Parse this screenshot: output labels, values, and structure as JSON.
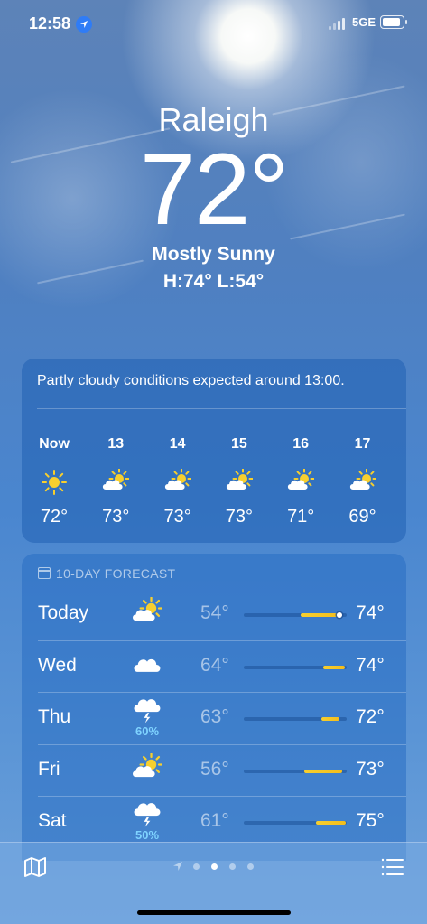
{
  "status_bar": {
    "time": "12:58",
    "network": "5GE"
  },
  "current": {
    "city": "Raleigh",
    "temperature": "72°",
    "condition": "Mostly Sunny",
    "high_low": "H:74°  L:54°"
  },
  "hourly": {
    "summary": "Partly cloudy conditions expected around 13:00.",
    "hours": [
      {
        "label": "Now",
        "icon": "sun-icon",
        "temp": "72°"
      },
      {
        "label": "13",
        "icon": "partly-cloudy-icon",
        "temp": "73°"
      },
      {
        "label": "14",
        "icon": "partly-cloudy-icon",
        "temp": "73°"
      },
      {
        "label": "15",
        "icon": "partly-cloudy-icon",
        "temp": "73°"
      },
      {
        "label": "16",
        "icon": "partly-cloudy-icon",
        "temp": "71°"
      },
      {
        "label": "17",
        "icon": "partly-cloudy-icon",
        "temp": "69°"
      }
    ]
  },
  "daily": {
    "header": "10-DAY FORECAST",
    "days": [
      {
        "name": "Today",
        "icon": "partly-cloudy-icon",
        "pop": "",
        "low": "54°",
        "high": "74°",
        "bar_start": 0.55,
        "bar_end": 0.95,
        "current_marker": 0.93
      },
      {
        "name": "Wed",
        "icon": "cloud-icon",
        "pop": "",
        "low": "64°",
        "high": "74°",
        "bar_start": 0.77,
        "bar_end": 0.98
      },
      {
        "name": "Thu",
        "icon": "thunderstorm-icon",
        "pop": "60%",
        "low": "63°",
        "high": "72°",
        "bar_start": 0.75,
        "bar_end": 0.93
      },
      {
        "name": "Fri",
        "icon": "partly-cloudy-icon",
        "pop": "",
        "low": "56°",
        "high": "73°",
        "bar_start": 0.59,
        "bar_end": 0.96
      },
      {
        "name": "Sat",
        "icon": "thunderstorm-icon",
        "pop": "50%",
        "low": "61°",
        "high": "75°",
        "bar_start": 0.7,
        "bar_end": 0.99
      }
    ]
  },
  "bottom": {
    "pages": 4,
    "active_page": 1
  },
  "colors": {
    "accent_yellow": "#f7cf2e",
    "precip_blue": "#7fd3ff",
    "location_blue": "#2f7cf6"
  }
}
